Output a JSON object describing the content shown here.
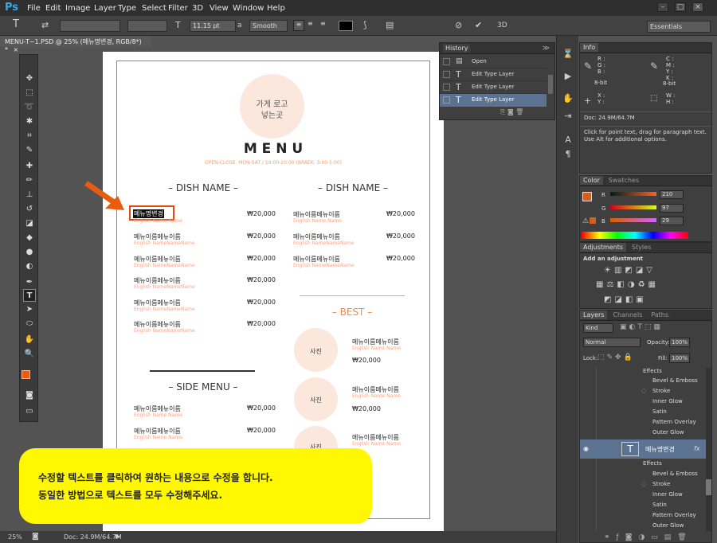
{
  "menubar": {
    "logo": "Ps",
    "items": [
      "File",
      "Edit",
      "Image",
      "Layer",
      "Type",
      "Select",
      "Filter",
      "3D",
      "View",
      "Window",
      "Help"
    ]
  },
  "options": {
    "font_size": "11.15 pt",
    "aa_label": "a",
    "aa": "Smooth",
    "workspace": "Essentials"
  },
  "doctab": {
    "title": "MENU-T~1.PSD @ 25% (메뉴명변경, RGB/8*) *",
    "close": "×"
  },
  "doc": {
    "logo_line1": "가게 로고",
    "logo_line2": "넣는곳",
    "title": "M E N U",
    "hours": "OPEN-CLOSE. MON-SAT / 10:00-20:00 (BRAEK. 3:00-5:00)",
    "dish_header_left": "– DISH NAME –",
    "dish_header_right": "– DISH NAME –",
    "selected_text": "메뉴명변경",
    "item_ko": "메뉴이름메뉴이름",
    "item_en": "English Name Name",
    "item_en_long": "English NameNameName",
    "price": "₩20,000",
    "side_header": "– SIDE MENU –",
    "best_header": "– BEST –",
    "photo_label": "사진"
  },
  "history": {
    "title": "History",
    "items": [
      "Open",
      "Edit Type Layer",
      "Edit Type Layer",
      "Edit Type Layer"
    ]
  },
  "info": {
    "title": "Info",
    "r": "R :",
    "g": "G :",
    "b": "B :",
    "c": "C :",
    "m": "M :",
    "y": "Y :",
    "k": "K :",
    "bit": "8-bit",
    "x": "X :",
    "yy": "Y :",
    "w": "W :",
    "h": "H :",
    "doc": "Doc: 24.9M/64.7M",
    "hint": "Click for point text, drag for paragraph text. Use Alt for additional options."
  },
  "color": {
    "tab1": "Color",
    "tab2": "Swatches",
    "r_label": "R",
    "g_label": "G",
    "b_label": "B",
    "r": "210",
    "g": "97",
    "b": "29",
    "fg": "#d2611d"
  },
  "adjust": {
    "tab1": "Adjustments",
    "tab2": "Styles",
    "label": "Add an adjustment"
  },
  "layers": {
    "tab1": "Layers",
    "tab2": "Channels",
    "tab3": "Paths",
    "kind": "Kind",
    "blend": "Normal",
    "opacity_label": "Opacity:",
    "opacity": "100%",
    "lock_label": "Lock:",
    "fill_label": "Fill:",
    "fill": "100%",
    "effects": "Effects",
    "fx": [
      "Bevel & Emboss",
      "Stroke",
      "Inner Glow",
      "Satin",
      "Pattern Overlay",
      "Outer Glow"
    ],
    "layer_name": "메뉴명변경",
    "fx_badge": "fx"
  },
  "status": {
    "zoom": "25%",
    "doc": "Doc: 24.9M/64.7M"
  },
  "callout": {
    "line1": "수정할 텍스트를 클릭하여 원하는 내용으로 수정을 합니다.",
    "line2": "동일한 방법으로 텍스트를 모두 수정해주세요."
  }
}
